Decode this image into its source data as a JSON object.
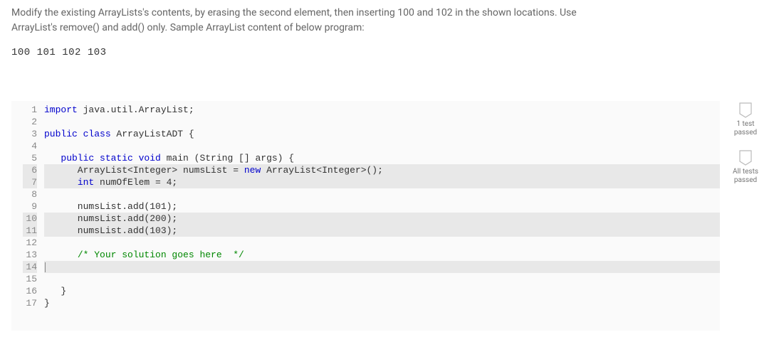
{
  "instructions": {
    "line1": "Modify the existing ArrayLists's contents, by erasing the second element, then inserting 100 and 102 in the shown locations. Use",
    "line2": "ArrayList's remove() and add() only. Sample ArrayList content of below program:"
  },
  "sample_output": "100 101 102 103",
  "code": {
    "lines": [
      {
        "n": "1",
        "hl": false,
        "html": "<span class='kw'>import</span> java.util.ArrayList;"
      },
      {
        "n": "2",
        "hl": false,
        "html": ""
      },
      {
        "n": "3",
        "hl": false,
        "html": "<span class='kw'>public class</span> ArrayListADT {"
      },
      {
        "n": "4",
        "hl": false,
        "html": ""
      },
      {
        "n": "5",
        "hl": false,
        "html": "   <span class='kw'>public static void</span> main (String [] args) {"
      },
      {
        "n": "6",
        "hl": true,
        "html": "      ArrayList&lt;Integer&gt; numsList = <span class='kw'>new</span> ArrayList&lt;Integer&gt;();"
      },
      {
        "n": "7",
        "hl": true,
        "html": "      <span class='kw'>int</span> numOfElem = 4;"
      },
      {
        "n": "8",
        "hl": false,
        "html": ""
      },
      {
        "n": "9",
        "hl": false,
        "html": "      numsList.add(101);"
      },
      {
        "n": "10",
        "hl": true,
        "html": "      numsList.add(200);"
      },
      {
        "n": "11",
        "hl": true,
        "html": "      numsList.add(103);"
      },
      {
        "n": "12",
        "hl": false,
        "html": ""
      },
      {
        "n": "13",
        "hl": false,
        "html": "      <span class='cmt'>/* Your solution goes here  */</span>"
      },
      {
        "n": "14",
        "hl": true,
        "html": "<span class='cursor-bar'></span>"
      },
      {
        "n": "15",
        "hl": false,
        "html": ""
      },
      {
        "n": "16",
        "hl": false,
        "html": "   }"
      },
      {
        "n": "17",
        "hl": false,
        "html": "}"
      }
    ]
  },
  "badges": {
    "test1": "1 test\npassed",
    "test_all": "All tests\npassed"
  }
}
